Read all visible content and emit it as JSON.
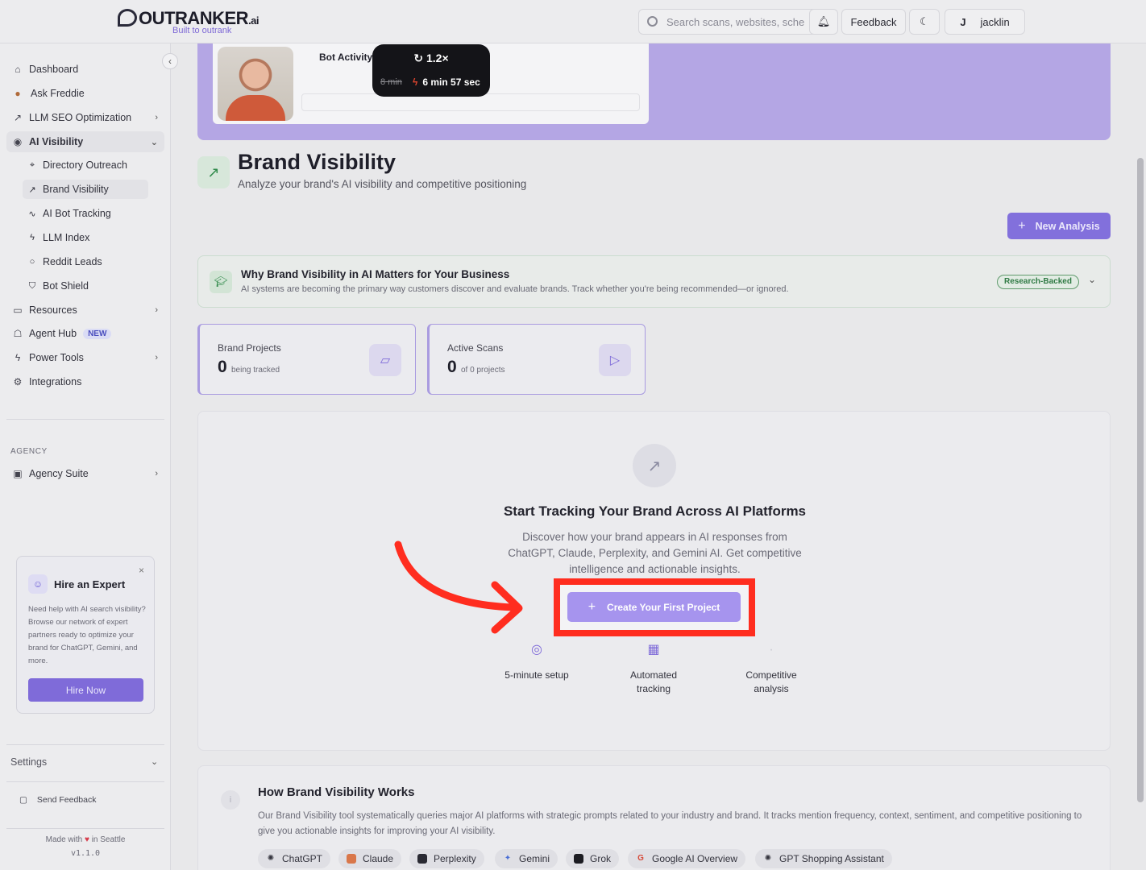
{
  "app": {
    "logo_text": "OUTRANKER",
    "logo_suffix": ".ai",
    "logo_tagline": "Built to outrank"
  },
  "topbar": {
    "search_placeholder": "Search scans, websites, sche",
    "feedback_label": "Feedback",
    "user_initial": "J",
    "user_name": "jacklin"
  },
  "sidebar": {
    "items": [
      {
        "label": "Dashboard",
        "icon": "home-icon"
      },
      {
        "label": "Ask Freddie",
        "icon": "freddie-avatar"
      },
      {
        "label": "LLM SEO Optimization",
        "icon": "trending-icon"
      },
      {
        "label": "AI Visibility",
        "icon": "eye-icon"
      },
      {
        "label": "Resources",
        "icon": "book-icon"
      },
      {
        "label": "Agent Hub",
        "icon": "robot-icon",
        "badge": "NEW"
      },
      {
        "label": "Power Tools",
        "icon": "bolt-icon"
      },
      {
        "label": "Integrations",
        "icon": "gear-icon"
      }
    ],
    "sub_items": [
      {
        "label": "Directory Outreach",
        "icon": "pin-icon"
      },
      {
        "label": "Brand Visibility",
        "icon": "trending-icon"
      },
      {
        "label": "AI Bot Tracking",
        "icon": "pulse-icon"
      },
      {
        "label": "LLM Index",
        "icon": "bolt-icon"
      },
      {
        "label": "Reddit Leads",
        "icon": "chat-icon"
      },
      {
        "label": "Bot Shield",
        "icon": "shield-icon"
      }
    ],
    "section_label": "AGENCY",
    "agency_item": "Agency Suite",
    "expert": {
      "title": "Hire an Expert",
      "description": "Need help with AI search visibility? Browse our network of expert partners ready to optimize your brand for ChatGPT, Gemini, and more.",
      "button": "Hire Now"
    },
    "settings_label": "Settings",
    "send_feedback": "Send Feedback",
    "made_with_prefix": "Made with",
    "made_with_suffix": "in Seattle",
    "version": "v1.1.0"
  },
  "video": {
    "title": "Bot Activity",
    "speed": "1.2×",
    "old_time": "8 min",
    "new_time": "6 min 57 sec"
  },
  "page": {
    "title": "Brand Visibility",
    "subtitle": "Analyze your brand's AI visibility and competitive positioning",
    "new_analysis": "New Analysis"
  },
  "why": {
    "title": "Why Brand Visibility in AI Matters for Your Business",
    "description": "AI systems are becoming the primary way customers discover and evaluate brands. Track whether you're being recommended—or ignored.",
    "badge": "Research-Backed"
  },
  "stats": [
    {
      "label": "Brand Projects",
      "value": "0",
      "unit": "being tracked",
      "icon": "folder-icon"
    },
    {
      "label": "Active Scans",
      "value": "0",
      "unit": "of 0 projects",
      "icon": "play-circle-icon"
    }
  ],
  "empty_state": {
    "title": "Start Tracking Your Brand Across AI Platforms",
    "description": "Discover how your brand appears in AI responses from ChatGPT, Claude, Perplexity, and Gemini AI. Get competitive intelligence and actionable insights.",
    "cta": "Create Your First Project",
    "features": [
      {
        "label": "5-minute setup",
        "icon": "play-circle-icon"
      },
      {
        "label": "Automated tracking",
        "icon": "calendar-icon"
      },
      {
        "label": "Competitive analysis",
        "icon": "target-icon"
      }
    ]
  },
  "how": {
    "title": "How Brand Visibility Works",
    "description": "Our Brand Visibility tool systematically queries major AI platforms with strategic prompts related to your industry and brand. It tracks mention frequency, context, sentiment, and competitive positioning to give you actionable insights for improving your AI visibility.",
    "platforms": [
      "ChatGPT",
      "Claude",
      "Perplexity",
      "Gemini",
      "Grok",
      "Google AI Overview",
      "GPT Shopping Assistant"
    ]
  },
  "colors": {
    "accent": "#8270dc",
    "highlight_red": "#ff2d1f",
    "green": "#2f8a4a"
  }
}
